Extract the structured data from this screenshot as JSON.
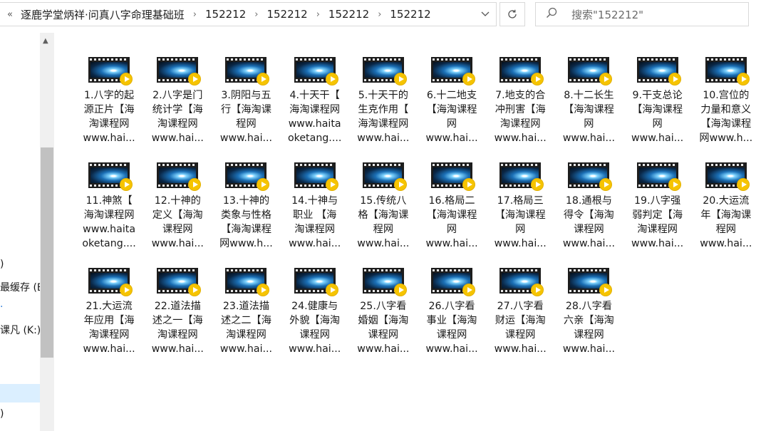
{
  "address_bar": {
    "overflow_glyph": "«",
    "breadcrumbs": [
      "逐鹿学堂炳祥·问真八字命理基础班",
      "152212",
      "152212",
      "152212",
      "152212"
    ],
    "separator": "›"
  },
  "search": {
    "placeholder": "搜索\"152212\""
  },
  "nav": {
    "items": [
      ")",
      "最缓存 (E:",
      "·",
      "课凡 (K:)",
      ")"
    ]
  },
  "files": [
    {
      "l1": "1.八字的起",
      "l2": "源正片【海",
      "l3": "淘课程网",
      "l4": "www.hai..."
    },
    {
      "l1": "2.八字是门",
      "l2": "统计学【海",
      "l3": "淘课程网",
      "l4": "www.hai..."
    },
    {
      "l1": "3.阴阳与五",
      "l2": "行【海淘课",
      "l3": "程网",
      "l4": "www.hai..."
    },
    {
      "l1": "4.十天干【",
      "l2": "海淘课程网",
      "l3": "www.haita",
      "l4": "oketang...."
    },
    {
      "l1": "5.十天干的",
      "l2": "生克作用【",
      "l3": "海淘课程网",
      "l4": "www.hai..."
    },
    {
      "l1": "6.十二地支",
      "l2": "【海淘课程",
      "l3": "网",
      "l4": "www.hai..."
    },
    {
      "l1": "7.地支的合",
      "l2": "冲刑害【海",
      "l3": "淘课程网",
      "l4": "www.hai..."
    },
    {
      "l1": "8.十二长生",
      "l2": "【海淘课程",
      "l3": "网",
      "l4": "www.hai..."
    },
    {
      "l1": "9.干支总论",
      "l2": "【海淘课程",
      "l3": "网",
      "l4": "www.hai..."
    },
    {
      "l1": "10.宫位的",
      "l2": "力量和意义",
      "l3": "【海淘课程",
      "l4": "网www.h..."
    },
    {
      "l1": "11.神煞【",
      "l2": "海淘课程网",
      "l3": "www.haita",
      "l4": "oketang...."
    },
    {
      "l1": "12.十神的",
      "l2": "定义【海淘",
      "l3": "课程网",
      "l4": "www.hai..."
    },
    {
      "l1": "13.十神的",
      "l2": "类象与性格",
      "l3": "【海淘课程",
      "l4": "网www.h..."
    },
    {
      "l1": "14.十神与",
      "l2": "职业 【海",
      "l3": "淘课程网",
      "l4": "www.hai..."
    },
    {
      "l1": "15.传统八",
      "l2": "格【海淘课",
      "l3": "程网",
      "l4": "www.hai..."
    },
    {
      "l1": "16.格局二",
      "l2": "【海淘课程",
      "l3": "网",
      "l4": "www.hai..."
    },
    {
      "l1": "17.格局三",
      "l2": "【海淘课程",
      "l3": "网",
      "l4": "www.hai..."
    },
    {
      "l1": "18.通根与",
      "l2": "得令【海淘",
      "l3": "课程网",
      "l4": "www.hai..."
    },
    {
      "l1": "19.八字强",
      "l2": "弱判定【海",
      "l3": "淘课程网",
      "l4": "www.hai..."
    },
    {
      "l1": "20.大运流",
      "l2": "年【海淘课",
      "l3": "程网",
      "l4": "www.hai..."
    },
    {
      "l1": "21.大运流",
      "l2": "年应用【海",
      "l3": "淘课程网",
      "l4": "www.hai..."
    },
    {
      "l1": "22.道法描",
      "l2": "述之一【海",
      "l3": "淘课程网",
      "l4": "www.hai..."
    },
    {
      "l1": "23.道法描",
      "l2": "述之二【海",
      "l3": "淘课程网",
      "l4": "www.hai..."
    },
    {
      "l1": "24.健康与",
      "l2": "外貌【海淘",
      "l3": "课程网",
      "l4": "www.hai..."
    },
    {
      "l1": "25.八字看",
      "l2": "婚姻【海淘",
      "l3": "课程网",
      "l4": "www.hai..."
    },
    {
      "l1": "26.八字看",
      "l2": "事业【海淘",
      "l3": "课程网",
      "l4": "www.hai..."
    },
    {
      "l1": "27.八字看",
      "l2": "财运【海淘",
      "l3": "课程网",
      "l4": "www.hai..."
    },
    {
      "l1": "28.八字看",
      "l2": "六亲【海淘",
      "l3": "课程网",
      "l4": "www.hai..."
    }
  ],
  "icons": {
    "back_overflow": "chevron-double-left-icon",
    "dropdown": "chevron-down-icon",
    "refresh": "refresh-icon",
    "search": "search-icon",
    "video_file": "video-file-icon",
    "play_badge": "play-badge-icon"
  },
  "colors": {
    "selection": "#cce8ff",
    "play_badge": "#f6c400",
    "border": "#d9d9d9"
  }
}
